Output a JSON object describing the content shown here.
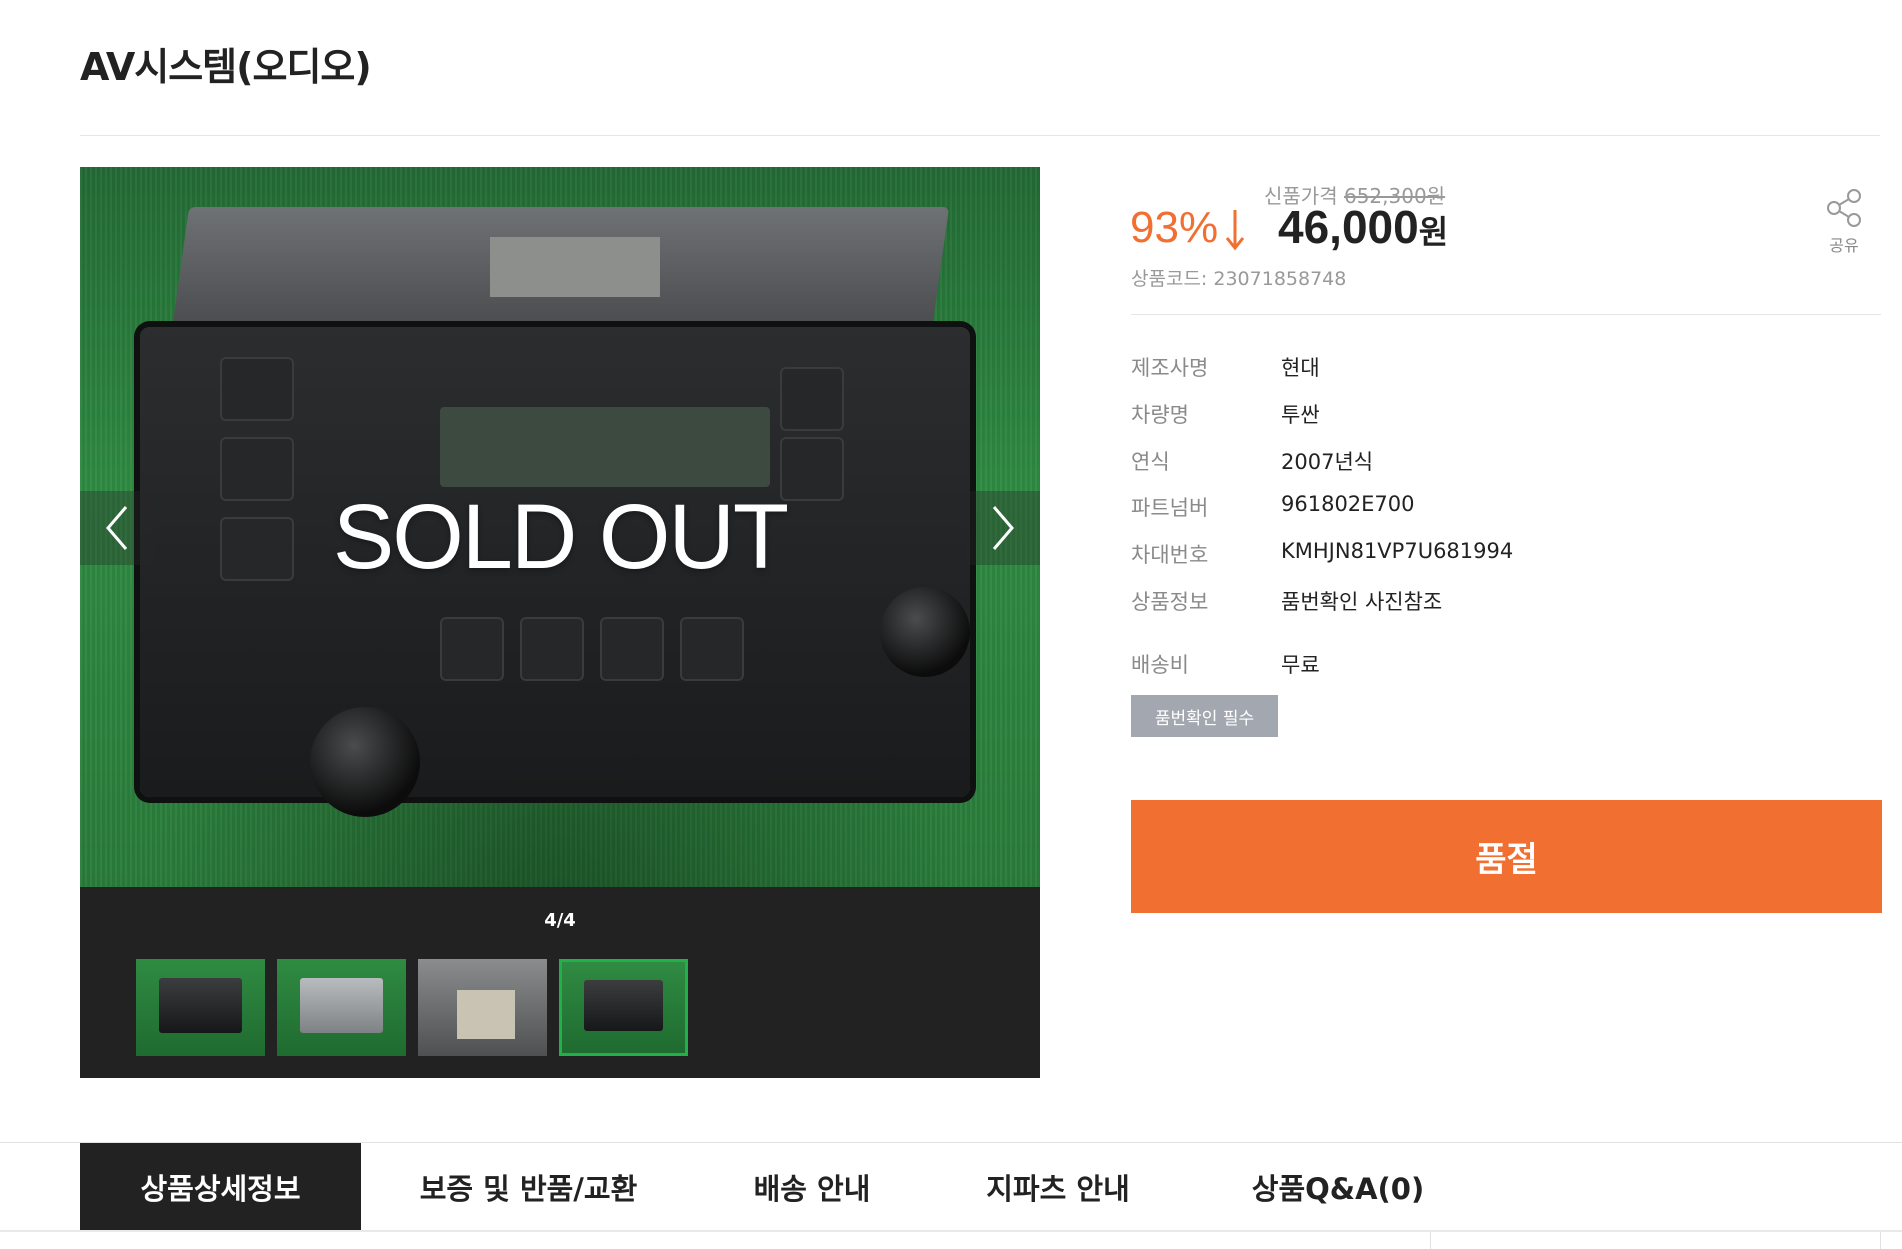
{
  "page": {
    "title": "AV시스템(오디오)"
  },
  "gallery": {
    "overlay_text": "SOLD OUT",
    "counter": "4/4",
    "current_index": 4,
    "total": 4,
    "prev_icon": "chevron-left-icon",
    "next_icon": "chevron-right-icon",
    "thumbnails": [
      {
        "label": "front-view",
        "active": false
      },
      {
        "label": "rear-view",
        "active": false
      },
      {
        "label": "label-view",
        "active": false
      },
      {
        "label": "front-view-2",
        "active": true
      }
    ]
  },
  "pricing": {
    "discount": "93%",
    "discount_icon": "arrow-down-icon",
    "original_label": "신품가격",
    "original_price": "652,300원",
    "price": "46,000",
    "currency": "원",
    "code_label": "상품코드:",
    "code": "23071858748"
  },
  "share": {
    "label": "공유",
    "icon": "share-icon"
  },
  "specs": [
    {
      "label": "제조사명",
      "value": "현대"
    },
    {
      "label": "차량명",
      "value": "투싼"
    },
    {
      "label": "연식",
      "value": "2007년식"
    },
    {
      "label": "파트넘버",
      "value": "961802E700"
    },
    {
      "label": "차대번호",
      "value": "KMHJN81VP7U681994"
    },
    {
      "label": "상품정보",
      "value": "품번확인 사진참조"
    }
  ],
  "shipping": {
    "label": "배송비",
    "value": "무료"
  },
  "badge": "품번확인 필수",
  "buy_button": "품절",
  "tabs": [
    {
      "label": "상품상세정보",
      "active": true
    },
    {
      "label": "보증 및 반품/교환",
      "active": false
    },
    {
      "label": "배송 안내",
      "active": false
    },
    {
      "label": "지파츠 안내",
      "active": false
    },
    {
      "label": "상품Q&A(0)",
      "active": false
    }
  ],
  "colors": {
    "accent": "#f26f32",
    "dark": "#222222",
    "badge": "#a3a8b0",
    "thumb_active": "#22b04a"
  }
}
